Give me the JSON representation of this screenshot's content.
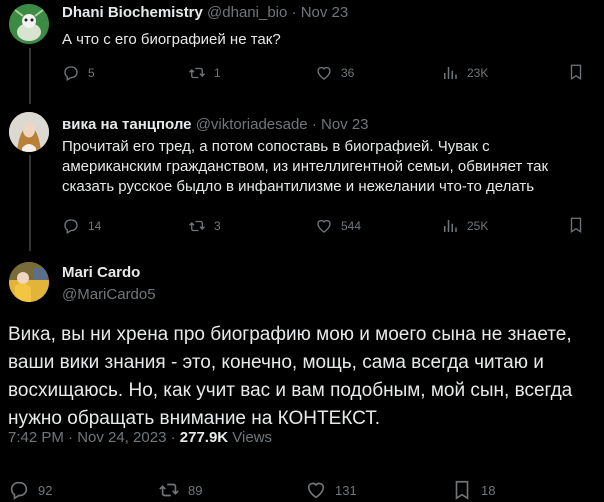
{
  "tweets": [
    {
      "name": "Dhani Biochemistry",
      "handle": "@dhani_bio",
      "sep": "·",
      "date": "Nov 23",
      "text": "А что с его биографией не так?",
      "replies": "5",
      "retweets": "1",
      "likes": "36",
      "views": "23K"
    },
    {
      "name": "вика на танцполе",
      "handle": "@viktoriadesade",
      "sep": "·",
      "date": "Nov 23",
      "text": "Прочитай его тред, а потом сопоставь в биографией. Чувак с американским гражданством, из интеллигентной семьи, обвиняет так сказать русское быдло в инфантилизме и нежелании что-то делать",
      "replies": "14",
      "retweets": "3",
      "likes": "544",
      "views": "25K"
    }
  ],
  "main": {
    "name": "Mari Cardo",
    "handle": "@MariCardo5",
    "text": "Вика, вы ни хрена про биографию мою и моего сына не знаете, ваши вики знания - это, конечно, мощь, сама всегда читаю и восхищаюсь. Но, как учит вас и вам подобным, мой сын, всегда нужно обращать внимание на КОНТЕКСТ.",
    "timestamp": "7:42 PM · Nov 24, 2023 · ",
    "views_count": "277.9K",
    "views_label": " Views",
    "replies": "92",
    "retweets": "89",
    "likes": "131",
    "bookmarks": "18"
  },
  "icons": [
    "reply-icon",
    "retweet-icon",
    "like-icon",
    "views-icon",
    "bookmark-icon"
  ],
  "colors": {
    "background": "#000000",
    "text": "#e7e9ea",
    "muted": "#71767b",
    "thread_line": "#333639"
  }
}
